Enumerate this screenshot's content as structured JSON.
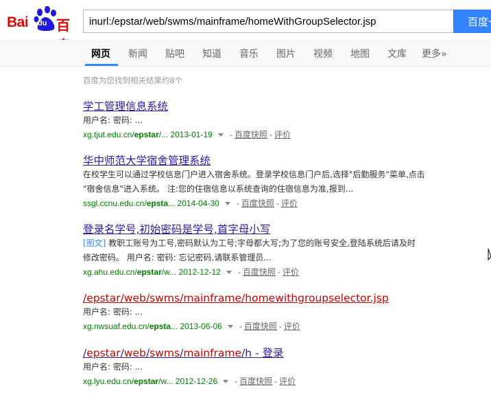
{
  "logo": {
    "bai": "Bai",
    "du": "du",
    "cn": "百度"
  },
  "search": {
    "query": "inurl:/epstar/web/swms/mainframe/homeWithGroupSelector.jsp",
    "button_label": "百度一下"
  },
  "nav": {
    "tabs": [
      {
        "label": "网页",
        "active": true
      },
      {
        "label": "新闻"
      },
      {
        "label": "贴吧"
      },
      {
        "label": "知道"
      },
      {
        "label": "音乐"
      },
      {
        "label": "图片"
      },
      {
        "label": "视频"
      },
      {
        "label": "地图"
      },
      {
        "label": "文库"
      },
      {
        "label": "更多»"
      }
    ]
  },
  "result_count": "百度为您找到相关结果约8个",
  "results": [
    {
      "title": "学工管理信息系统",
      "abstract": [
        "用户名: 密码: ..."
      ],
      "url_pre": "xg.tjut.edu.cn/",
      "url_bold": "epstar",
      "url_post": "/...",
      "date": "2013-01-19",
      "cache": "百度快照",
      "rate": "评价"
    },
    {
      "title": "华中师范大学宿舍管理系统",
      "abstract": [
        "在校学生可以通过学校信息门户进入宿舍系统。登录学校信息门户后,选择\"后勤服务\"菜单,点击",
        "\"宿舍信息\"进入系统。 注:您的住宿信息以系统查询的住宿信息为准,报到..."
      ],
      "url_pre": "ssgl.ccnu.edu.cn/",
      "url_bold": "epsta",
      "url_post": "...",
      "date": "2014-04-30",
      "cache": "百度快照",
      "rate": "评价"
    },
    {
      "title": "登录名学号,初始密码是学号,首字母小写",
      "tag": "[图文]",
      "abstract": [
        "教职工账号为工号,密码默认为工号;字母都大写;为了您的账号安全,登陆系统后请及时",
        "修改密码。 用户名: 密码: 忘记密码,请联系管理员..."
      ],
      "url_pre": "xg.ahu.edu.cn/",
      "url_bold": "epstar",
      "url_post": "/w...",
      "date": "2012-12-12",
      "cache": "百度快照",
      "rate": "评价"
    },
    {
      "title_parts": [
        "/",
        "epstar",
        "/",
        "web",
        "/",
        "swms",
        "/",
        "mainframe",
        "/",
        "homewithgroupselector.jsp"
      ],
      "abstract": [
        "用户名: 密码: ..."
      ],
      "url_pre": "xg.nwsuaf.edu.cn/",
      "url_bold": "epsta",
      "url_post": "...",
      "date": "2013-06-06",
      "cache": "百度快照",
      "rate": "评价"
    },
    {
      "title_parts": [
        "/",
        "epstar",
        "/",
        "web",
        "/",
        "swms",
        "/",
        "mainframe",
        "/",
        "h - 登录"
      ],
      "abstract": [
        "用户名: 密码: ..."
      ],
      "url_pre": "xg.lyu.edu.cn/",
      "url_bold": "epstar",
      "url_post": "/w...",
      "date": "2012-12-26",
      "cache": "百度快照",
      "rate": "评价"
    }
  ]
}
